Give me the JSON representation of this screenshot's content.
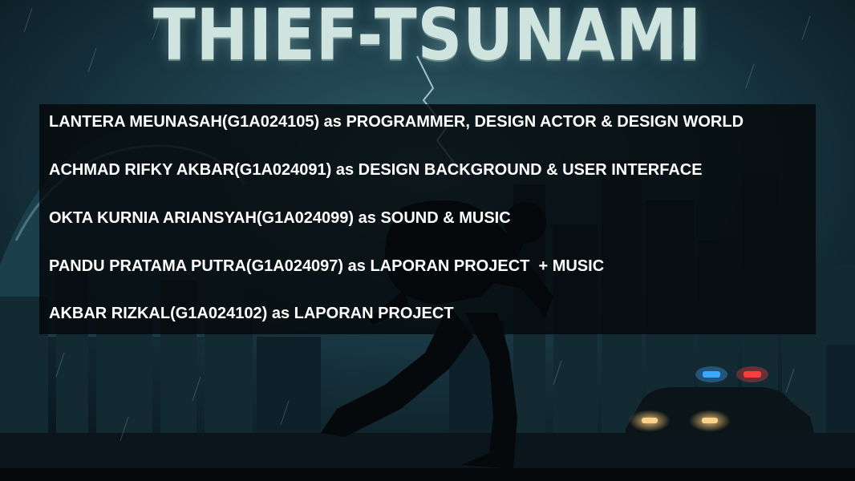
{
  "game": {
    "title": "THIEF-TSUNAMI"
  },
  "credits": [
    {
      "text": "LANTERA MEUNASAH(G1A024105) as PROGRAMMER, DESIGN ACTOR & DESIGN WORLD"
    },
    {
      "text": "ACHMAD RIFKY AKBAR(G1A024091) as DESIGN BACKGROUND & USER INTERFACE"
    },
    {
      "text": "OKTA KURNIA ARIANSYAH(G1A024099) as SOUND & MUSIC"
    },
    {
      "text": "PANDU PRATAMA PUTRA(G1A024097) as LAPORAN PROJECT  + MUSIC"
    },
    {
      "text": "AKBAR RIZKAL(G1A024102) as LAPORAN PROJECT"
    }
  ],
  "colors": {
    "sky": "#16323d",
    "panel": "#05080a",
    "title": "#cfe3df",
    "police_red": "#ff3b3b",
    "police_blue": "#3ba9ff"
  }
}
